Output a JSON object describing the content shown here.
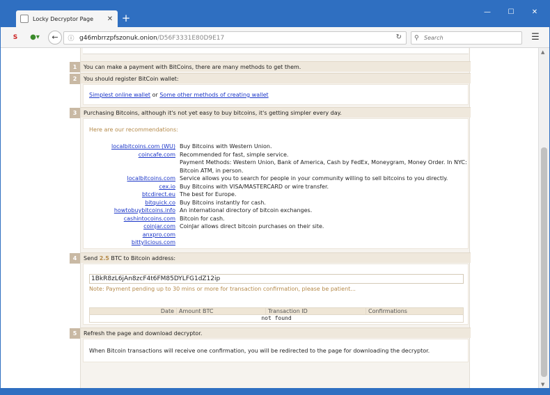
{
  "browser": {
    "tab_title": "Locky Decryptor Page",
    "url_host": "g46mbrrzpfszonuk.onion",
    "url_path": "/D56F3331E80D9E17",
    "search_placeholder": "Search",
    "controls": {
      "minimize": "—",
      "maximize": "☐",
      "close": "✕",
      "new_tab": "+",
      "tab_close": "✕"
    }
  },
  "steps": {
    "s1": {
      "num": "1",
      "text": "You can make a payment with BitCoins, there are many methods to get them."
    },
    "s2": {
      "num": "2",
      "text": "You should register BitCoin wallet:",
      "link1": "Simplest online wallet",
      "or": " or ",
      "link2": "Some other methods of creating wallet"
    },
    "s3": {
      "num": "3",
      "text": "Purchasing Bitcoins, although it's not yet easy to buy bitcoins, it's getting simpler every day.",
      "recommend_title": "Here are our recommendations:",
      "rows": [
        {
          "link": "localbitcoins.com (WU)",
          "desc": "Buy Bitcoins with Western Union."
        },
        {
          "link": "coincafe.com",
          "desc": "Recommended for fast, simple service."
        },
        {
          "link": "",
          "desc": "Payment Methods: Western Union, Bank of America, Cash by FedEx, Moneygram, Money Order. In NYC:"
        },
        {
          "link": "",
          "desc": "Bitcoin ATM, in person."
        },
        {
          "link": "localbitcoins.com",
          "desc": "Service allows you to search for people in your community willing to sell bitcoins to you directly."
        },
        {
          "link": "cex.io",
          "desc": "Buy Bitcoins with VISA/MASTERCARD or wire transfer."
        },
        {
          "link": "btcdirect.eu",
          "desc": "The best for Europe."
        },
        {
          "link": "bitquick.co",
          "desc": "Buy Bitcoins instantly for cash."
        },
        {
          "link": "howtobuybitcoins.info",
          "desc": "An international directory of bitcoin exchanges."
        },
        {
          "link": "cashintocoins.com",
          "desc": "Bitcoin for cash."
        },
        {
          "link": "coinjar.com",
          "desc": "CoinJar allows direct bitcoin purchases on their site."
        },
        {
          "link": "anxpro.com",
          "desc": ""
        },
        {
          "link": "bittylicious.com",
          "desc": ""
        }
      ]
    },
    "s4": {
      "num": "4",
      "text_pre": "Send ",
      "amount": "2.5",
      "text_post": " BTC to Bitcoin address:",
      "address": "1BkR8zL6jAn8zcF4t6FM85DYLFG1dZ12ip",
      "note": "Note: Payment pending up to 30 mins or more for transaction confirmation, please be patient...",
      "table_headers": [
        "Date",
        "Amount BTC",
        "Transaction ID",
        "Confirmations"
      ],
      "empty": "not found"
    },
    "s5": {
      "num": "5",
      "text": "Refresh the page and download decryptor.",
      "body": "When Bitcoin transactions will receive one confirmation, you will be redirected to the page for downloading the decryptor."
    }
  },
  "colors": {
    "chrome_blue": "#2f6fc1",
    "step_bg": "#efe8dc",
    "badge": "#c9b9a4",
    "link": "#1a35c8",
    "accent_text": "#b58a4a"
  }
}
